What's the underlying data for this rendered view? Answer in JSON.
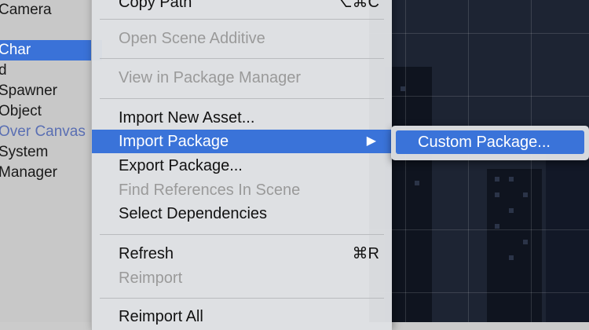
{
  "hierarchy": {
    "items": [
      {
        "label": "Camera"
      },
      {
        "label": "Char"
      },
      {
        "label": "d"
      },
      {
        "label": "Spawner"
      },
      {
        "label": "Object"
      },
      {
        "label": "Over Canvas"
      },
      {
        "label": "System"
      },
      {
        "label": "Manager"
      }
    ]
  },
  "context_menu": {
    "copy_path": {
      "label": "Copy Path",
      "shortcut": "⌥⌘C"
    },
    "open_scene_additive": {
      "label": "Open Scene Additive"
    },
    "view_in_package_manager": {
      "label": "View in Package Manager"
    },
    "import_new_asset": {
      "label": "Import New Asset..."
    },
    "import_package": {
      "label": "Import Package",
      "arrow": "▶"
    },
    "export_package": {
      "label": "Export Package..."
    },
    "find_references": {
      "label": "Find References In Scene"
    },
    "select_dependencies": {
      "label": "Select Dependencies"
    },
    "refresh": {
      "label": "Refresh",
      "shortcut": "⌘R"
    },
    "reimport": {
      "label": "Reimport"
    },
    "reimport_all": {
      "label": "Reimport All"
    }
  },
  "submenu": {
    "custom_package": {
      "label": "Custom Package..."
    }
  },
  "colors": {
    "highlight": "#3a73d9",
    "selection": "#3a72d8",
    "scene_bg": "#1d2433"
  }
}
